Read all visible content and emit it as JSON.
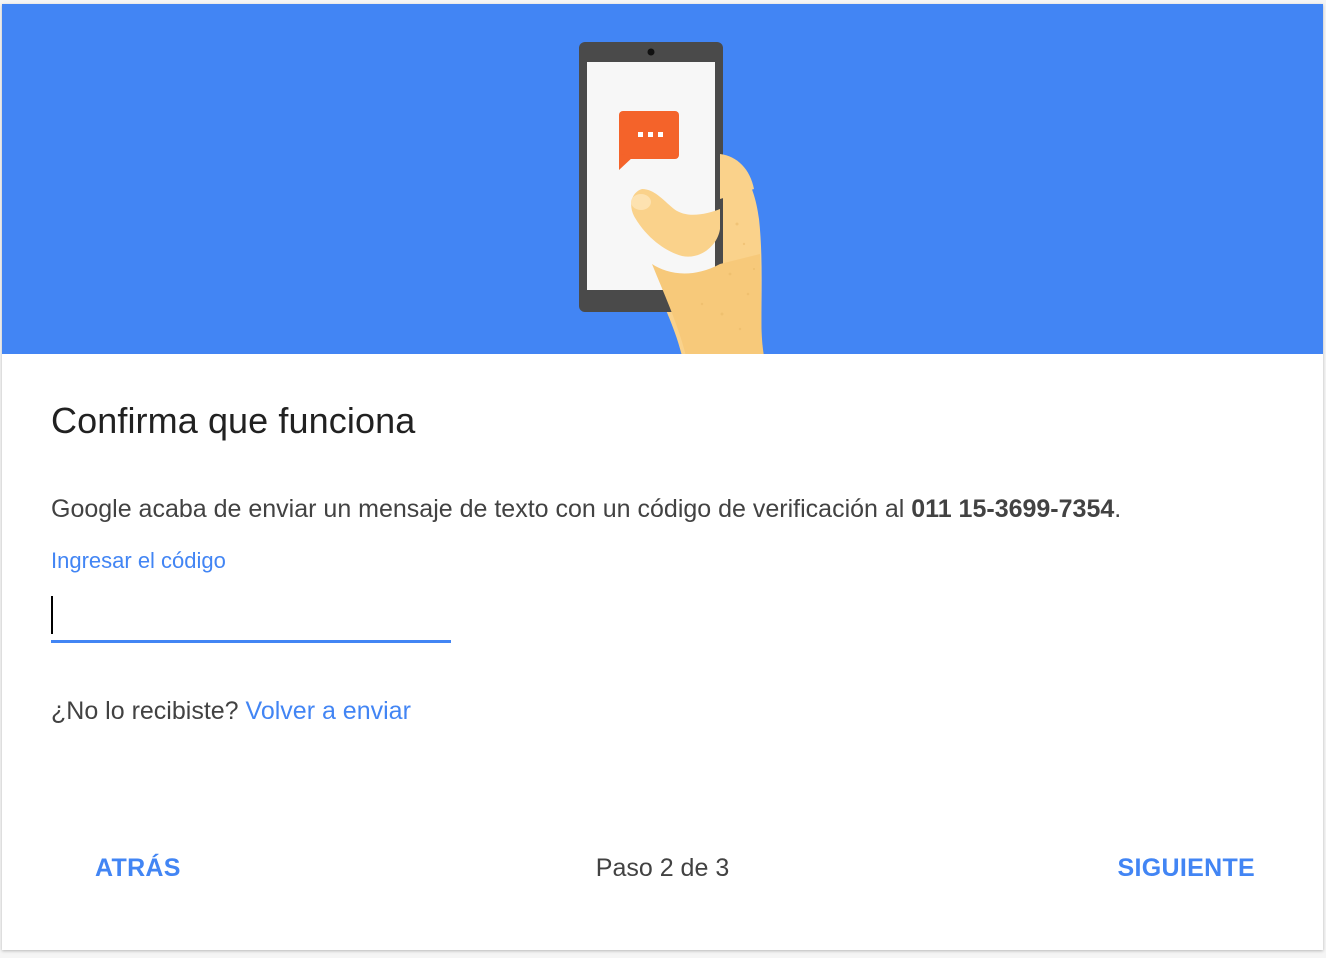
{
  "colors": {
    "hero_background": "#4285f4",
    "accent": "#4285f4",
    "message_bubble": "#f4632a",
    "phone_body": "#4a4a4a",
    "hand_skin": "#fad28b"
  },
  "hero": {
    "illustration": "phone-with-text-message-icon"
  },
  "title": "Confirma que funciona",
  "description": {
    "text": "Google acaba de enviar un mensaje de texto con un código de verificación al ",
    "phone_number": "011 15-3699-7354",
    "suffix": "."
  },
  "code_field": {
    "label": "Ingresar el código",
    "value": ""
  },
  "resend": {
    "prompt": "¿No lo recibiste? ",
    "link": "Volver a enviar"
  },
  "footer": {
    "back_label": "ATRÁS",
    "step_label": "Paso 2 de 3",
    "next_label": "SIGUIENTE"
  }
}
